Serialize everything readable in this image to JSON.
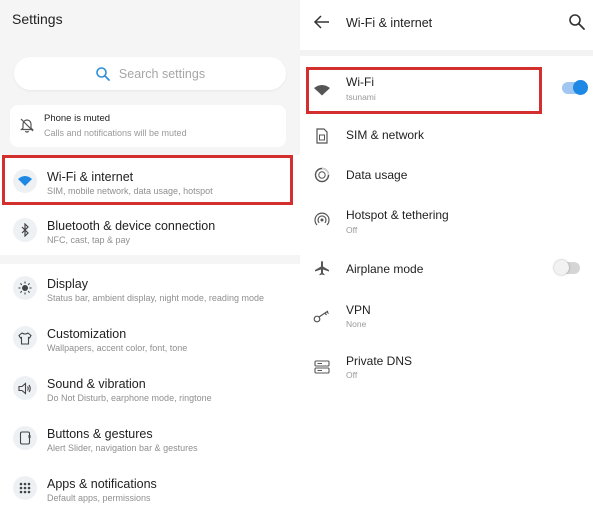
{
  "left": {
    "title": "Settings",
    "search_placeholder": "Search settings",
    "muted": {
      "title": "Phone is muted",
      "subtitle": "Calls and notifications will be muted"
    },
    "items": [
      {
        "title": "Wi-Fi & internet",
        "subtitle": "SIM, mobile network, data usage, hotspot",
        "icon": "wifi-icon"
      },
      {
        "title": "Bluetooth & device connection",
        "subtitle": "NFC, cast, tap & pay",
        "icon": "bluetooth-icon"
      },
      {
        "title": "Display",
        "subtitle": "Status bar, ambient display, night mode, reading mode",
        "icon": "brightness-icon"
      },
      {
        "title": "Customization",
        "subtitle": "Wallpapers, accent color, font, tone",
        "icon": "shirt-icon"
      },
      {
        "title": "Sound & vibration",
        "subtitle": "Do Not Disturb, earphone mode, ringtone",
        "icon": "speaker-icon"
      },
      {
        "title": "Buttons & gestures",
        "subtitle": "Alert Slider, navigation bar & gestures",
        "icon": "buttons-icon"
      },
      {
        "title": "Apps & notifications",
        "subtitle": "Default apps, permissions",
        "icon": "apps-grid-icon"
      }
    ]
  },
  "right": {
    "title": "Wi-Fi & internet",
    "items": [
      {
        "title": "Wi-Fi",
        "subtitle": "tsunami",
        "icon": "wifi-icon",
        "toggle": true
      },
      {
        "title": "SIM & network",
        "subtitle": "",
        "icon": "sim-card-icon"
      },
      {
        "title": "Data usage",
        "subtitle": "",
        "icon": "data-usage-icon"
      },
      {
        "title": "Hotspot & tethering",
        "subtitle": "Off",
        "icon": "hotspot-icon"
      },
      {
        "title": "Airplane mode",
        "subtitle": "",
        "icon": "airplane-icon",
        "toggle": false
      },
      {
        "title": "VPN",
        "subtitle": "None",
        "icon": "key-icon"
      },
      {
        "title": "Private DNS",
        "subtitle": "Off",
        "icon": "dns-server-icon"
      }
    ]
  },
  "colors": {
    "accent": "#1e88e5",
    "highlight": "#d32f2f",
    "panel_bg": "#f5f5f5"
  }
}
